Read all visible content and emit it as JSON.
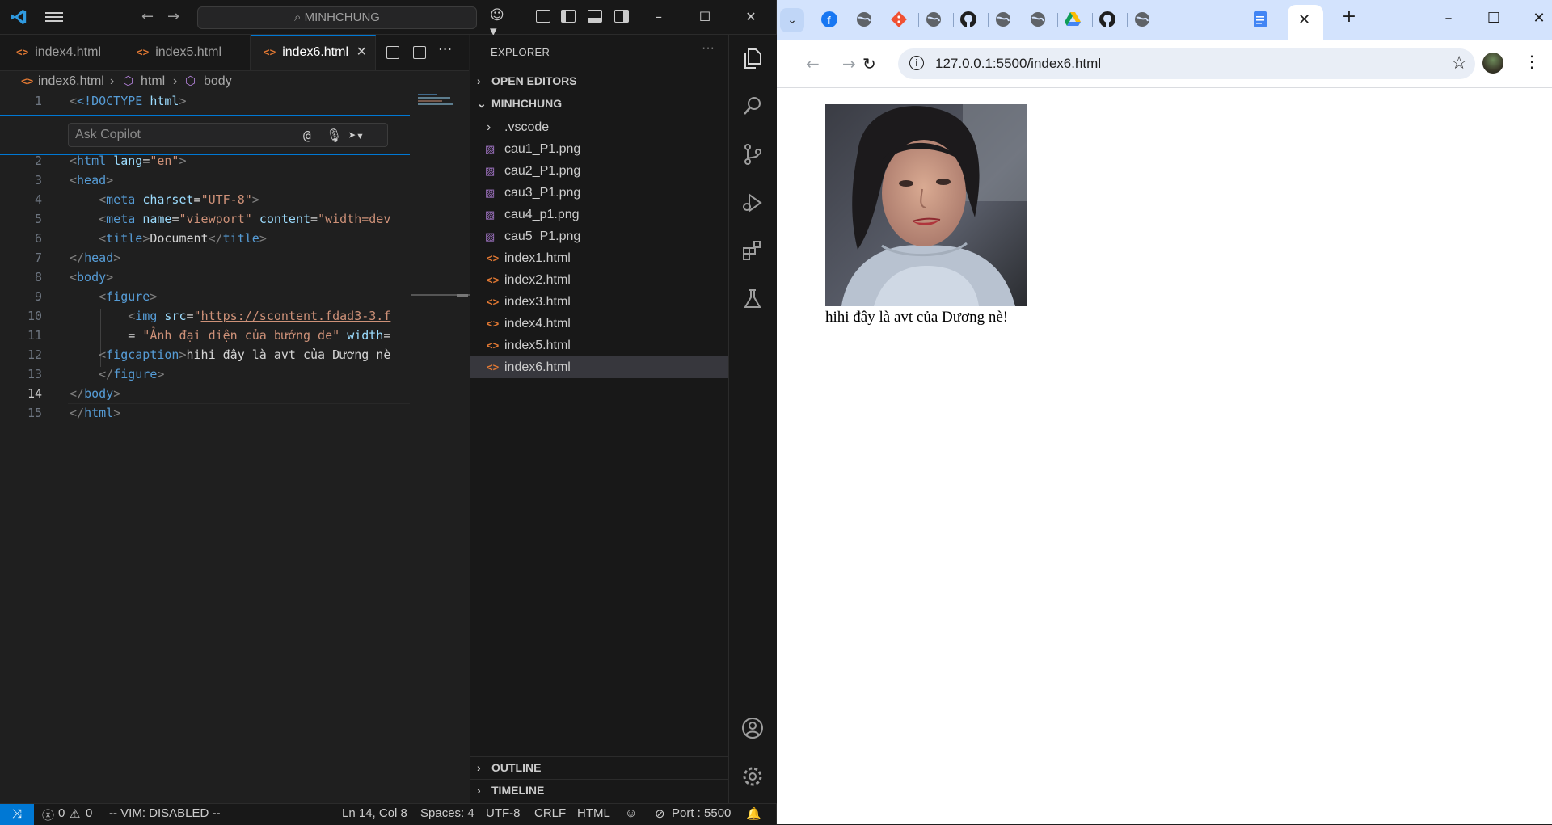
{
  "vscode": {
    "search_text": "MINHCHUNG",
    "tabs": [
      {
        "label": "index4.html",
        "active": false
      },
      {
        "label": "index5.html",
        "active": false
      },
      {
        "label": "index6.html",
        "active": true
      }
    ],
    "breadcrumb": {
      "file": "index6.html",
      "node1": "html",
      "node2": "body"
    },
    "copilot_placeholder": "Ask Copilot",
    "line_numbers": [
      "1",
      "2",
      "3",
      "4",
      "5",
      "6",
      "7",
      "8",
      "9",
      "10",
      "11",
      "12",
      "13",
      "14",
      "15"
    ],
    "code": {
      "l1_doctype": "<!DOCTYPE",
      "l1_html": "html",
      "l2_lang": "\"en\"",
      "l4_charset": "\"UTF-8\"",
      "l5_viewport": "\"viewport\"",
      "l5_content": "\"width=dev",
      "l6_title": "Document",
      "l10_src": "https://scontent.fdad3-3.f",
      "l11_alt": "\"Ảnh đại diện của bướng de\"",
      "l12_caption": "hihi đây là avt của Dương nè"
    },
    "explorer": {
      "header": "EXPLORER",
      "open_editors": "OPEN EDITORS",
      "folder": "MINHCHUNG",
      "items": [
        {
          "label": ".vscode",
          "type": "folder"
        },
        {
          "label": "cau1_P1.png",
          "type": "image"
        },
        {
          "label": "cau2_P1.png",
          "type": "image"
        },
        {
          "label": "cau3_P1.png",
          "type": "image"
        },
        {
          "label": "cau4_p1.png",
          "type": "image"
        },
        {
          "label": "cau5_P1.png",
          "type": "image"
        },
        {
          "label": "index1.html",
          "type": "html"
        },
        {
          "label": "index2.html",
          "type": "html"
        },
        {
          "label": "index3.html",
          "type": "html"
        },
        {
          "label": "index4.html",
          "type": "html"
        },
        {
          "label": "index5.html",
          "type": "html"
        },
        {
          "label": "index6.html",
          "type": "html",
          "selected": true
        }
      ],
      "outline": "OUTLINE",
      "timeline": "TIMELINE"
    },
    "status": {
      "errors": "0",
      "warnings": "0",
      "vim": "-- VIM: DISABLED --",
      "position": "Ln 14, Col 8",
      "spaces": "Spaces: 4",
      "encoding": "UTF-8",
      "eol": "CRLF",
      "language": "HTML",
      "port": "Port : 5500"
    },
    "colors": {
      "accent": "#0078d4",
      "background": "#1f1f1f",
      "sidebar": "#181818"
    }
  },
  "browser": {
    "url": "127.0.0.1:5500/index6.html",
    "caption": "hihi đây là avt của Dương nè!",
    "tab_icons": [
      "facebook-icon",
      "globe-icon",
      "git-icon",
      "globe-icon",
      "github-icon",
      "globe-icon",
      "globe-icon",
      "google-drive-icon",
      "github-icon",
      "globe-icon",
      "google-docs-icon"
    ],
    "colors": {
      "tabstrip": "#d3e3fd",
      "omnibox": "#e9eef6"
    }
  }
}
